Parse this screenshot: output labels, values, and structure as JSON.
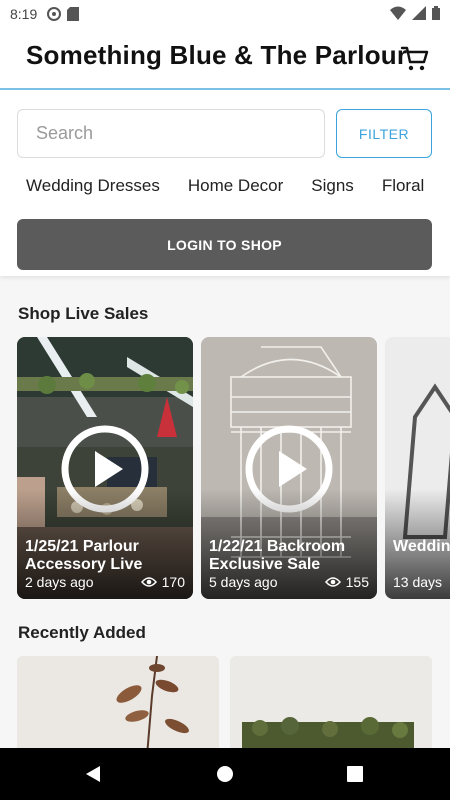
{
  "status_bar": {
    "time": "8:19"
  },
  "header": {
    "title": "Something Blue & The Parlour",
    "cart_icon": "shopping-cart-icon"
  },
  "search": {
    "placeholder": "Search",
    "value": ""
  },
  "filter_button": {
    "label": "FILTER",
    "color": "#3ba3dd"
  },
  "categories": [
    "Wedding Dresses",
    "Home Decor",
    "Signs",
    "Floral"
  ],
  "login_button": {
    "label": "LOGIN TO SHOP",
    "color": "#5b5b5b"
  },
  "live_sales": {
    "title": "Shop Live Sales",
    "items": [
      {
        "title": "1/25/21 Parlour Accessory Live",
        "age": "2 days ago",
        "views": "170"
      },
      {
        "title": "1/22/21 Backroom Exclusive Sale",
        "age": "5 days ago",
        "views": "155"
      },
      {
        "title": "Wedding Evening Off",
        "age": "13 days",
        "views": ""
      }
    ]
  },
  "recently_added": {
    "title": "Recently Added"
  },
  "accent_color": "#7cc1e8"
}
